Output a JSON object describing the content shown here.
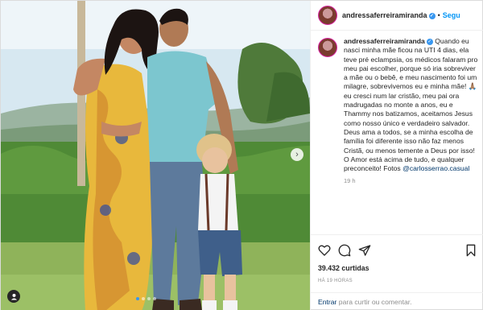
{
  "header": {
    "username": "andressaferreiramiranda",
    "separator": "•",
    "follow_label": "Segu"
  },
  "caption": {
    "username": "andressaferreiramiranda",
    "text": "Quando eu nasci minha mãe ficou na UTI 4 dias, ela teve pré eclampsia, os médicos falaram pro meu pai escolher, porque só iria sobreviver a mãe ou o bebê, e meu nascimento foi um milagre, sobrevivemos eu e minha mãe! 🙏🏽 eu cresci num lar cristão, meu pai ora madrugadas no monte a anos, eu e Thammy nos batizamos, aceitamos Jesus como nosso único e verdadeiro salvador. Deus ama a todos, se a minha escolha de família foi diferente isso não faz menos Cristã, ou menos temente a Deus por isso! O Amor está acima de tudo, e qualquer preconceito!",
    "photo_credit_prefix": "Fotos",
    "photo_credit_mention": "@carlosserrao.casual",
    "time": "19 h"
  },
  "likes_text": "39.432 curtidas",
  "post_time": "HÁ 19 HORAS",
  "comment": {
    "login_link": "Entrar",
    "prompt": " para curtir ou comentar."
  },
  "carousel": {
    "slides": 4,
    "active_index": 0
  },
  "colors": {
    "accent": "#0095f6",
    "verified": "#3897f0",
    "text": "#262626",
    "muted": "#8e8e8e"
  },
  "icons": [
    "heart-icon",
    "comment-icon",
    "share-icon",
    "save-icon",
    "user-tag-icon",
    "chevron-right-icon",
    "verified-icon"
  ]
}
